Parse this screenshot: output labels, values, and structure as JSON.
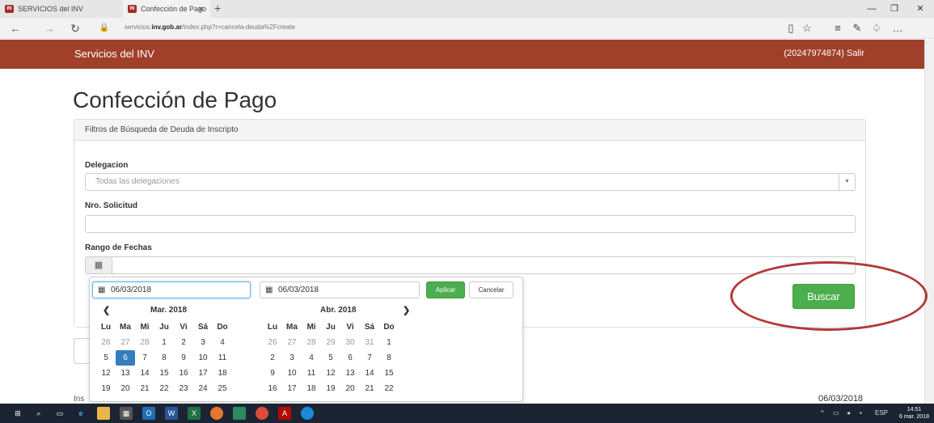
{
  "browser": {
    "tabs": [
      {
        "label": "SERVICIOS del INV",
        "active": false
      },
      {
        "label": "Confección de Pago",
        "active": true
      }
    ],
    "url_prefix": "servicios.",
    "url_domain": "inv.gob.ar",
    "url_path": "/index.php?r=cancela-deuda%2Fcreate"
  },
  "header": {
    "brand": "Servicios del INV",
    "user": "(20247974874) Salir",
    "color": "#a0402a"
  },
  "page": {
    "title": "Confección de Pago",
    "panel_title": "Filtros de Búsqueda de Deuda de Inscripto"
  },
  "form": {
    "delegacion_label": "Delegacion",
    "delegacion_value": "Todas las delegaciones",
    "solicitud_label": "Nro. Solicitud",
    "rango_label": "Rango de Fechas",
    "buscar_label": "Buscar"
  },
  "picker": {
    "start_date": "06/03/2018",
    "end_date": "06/03/2018",
    "apply_label": "Aplicar",
    "cancel_label": "Cancelar",
    "weekdays": [
      "Lu",
      "Ma",
      "Mi",
      "Ju",
      "Vi",
      "Sá",
      "Do"
    ],
    "left": {
      "title": "Mar. 2018",
      "days": [
        {
          "d": "26",
          "off": true
        },
        {
          "d": "27",
          "off": true
        },
        {
          "d": "28",
          "off": true
        },
        {
          "d": "1"
        },
        {
          "d": "2"
        },
        {
          "d": "3"
        },
        {
          "d": "4"
        },
        {
          "d": "5"
        },
        {
          "d": "6",
          "sel": true
        },
        {
          "d": "7"
        },
        {
          "d": "8"
        },
        {
          "d": "9"
        },
        {
          "d": "10"
        },
        {
          "d": "11"
        },
        {
          "d": "12"
        },
        {
          "d": "13"
        },
        {
          "d": "14"
        },
        {
          "d": "15"
        },
        {
          "d": "16"
        },
        {
          "d": "17"
        },
        {
          "d": "18"
        },
        {
          "d": "19"
        },
        {
          "d": "20"
        },
        {
          "d": "21"
        },
        {
          "d": "22"
        },
        {
          "d": "23"
        },
        {
          "d": "24"
        },
        {
          "d": "25"
        }
      ]
    },
    "right": {
      "title": "Abr. 2018",
      "days": [
        {
          "d": "26",
          "off": true
        },
        {
          "d": "27",
          "off": true
        },
        {
          "d": "28",
          "off": true
        },
        {
          "d": "29",
          "off": true
        },
        {
          "d": "30",
          "off": true
        },
        {
          "d": "31",
          "off": true
        },
        {
          "d": "1"
        },
        {
          "d": "2"
        },
        {
          "d": "3"
        },
        {
          "d": "4"
        },
        {
          "d": "5"
        },
        {
          "d": "6"
        },
        {
          "d": "7"
        },
        {
          "d": "8"
        },
        {
          "d": "9"
        },
        {
          "d": "10"
        },
        {
          "d": "11"
        },
        {
          "d": "12"
        },
        {
          "d": "13"
        },
        {
          "d": "14"
        },
        {
          "d": "15"
        },
        {
          "d": "16"
        },
        {
          "d": "17"
        },
        {
          "d": "18"
        },
        {
          "d": "19"
        },
        {
          "d": "20"
        },
        {
          "d": "21"
        },
        {
          "d": "22"
        }
      ]
    }
  },
  "footer": {
    "left_text": "Ins",
    "date": "06/03/2018"
  },
  "taskbar": {
    "lang": "ESP",
    "time": "14:51",
    "date": "6 mar. 2018"
  }
}
